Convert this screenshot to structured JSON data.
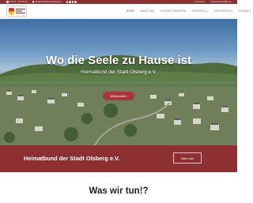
{
  "topbar": {
    "phone": "0 29 62 - 8 03 04 06",
    "email": "info@heimatbund-olsberg.de",
    "social_icons": [
      "facebook-icon",
      "twitter-icon",
      "google-plus-icon",
      "instagram-icon"
    ],
    "links": [
      "Impressum",
      "Datenschutzerklärung"
    ]
  },
  "header": {
    "logo": "heimatbund-olsberg-logo",
    "nav": [
      {
        "label": "HOME",
        "active": true,
        "dropdown": false
      },
      {
        "label": "ÜBER UNS",
        "active": false,
        "dropdown": false
      },
      {
        "label": "PROJEKTGRUPPEN",
        "active": false,
        "dropdown": false
      },
      {
        "label": "PROJEKTE",
        "active": false,
        "dropdown": true
      },
      {
        "label": "NEUIGKEITEN",
        "active": false,
        "dropdown": false
      },
      {
        "label": "KONTAKT",
        "active": false,
        "dropdown": false
      }
    ]
  },
  "hero": {
    "title": "Wo die Seele zu Hause ist",
    "subtitle": "Heimatbund der Stadt Olsberg e.V.",
    "button_label": "Willkommen"
  },
  "banner": {
    "title": "Heimatbund der Stadt Olsberg e.V.",
    "button_label": "Über uns"
  },
  "section": {
    "title": "Was wir tun!?"
  },
  "colors": {
    "brand": "#8e2f32",
    "button": "#a8363a"
  }
}
